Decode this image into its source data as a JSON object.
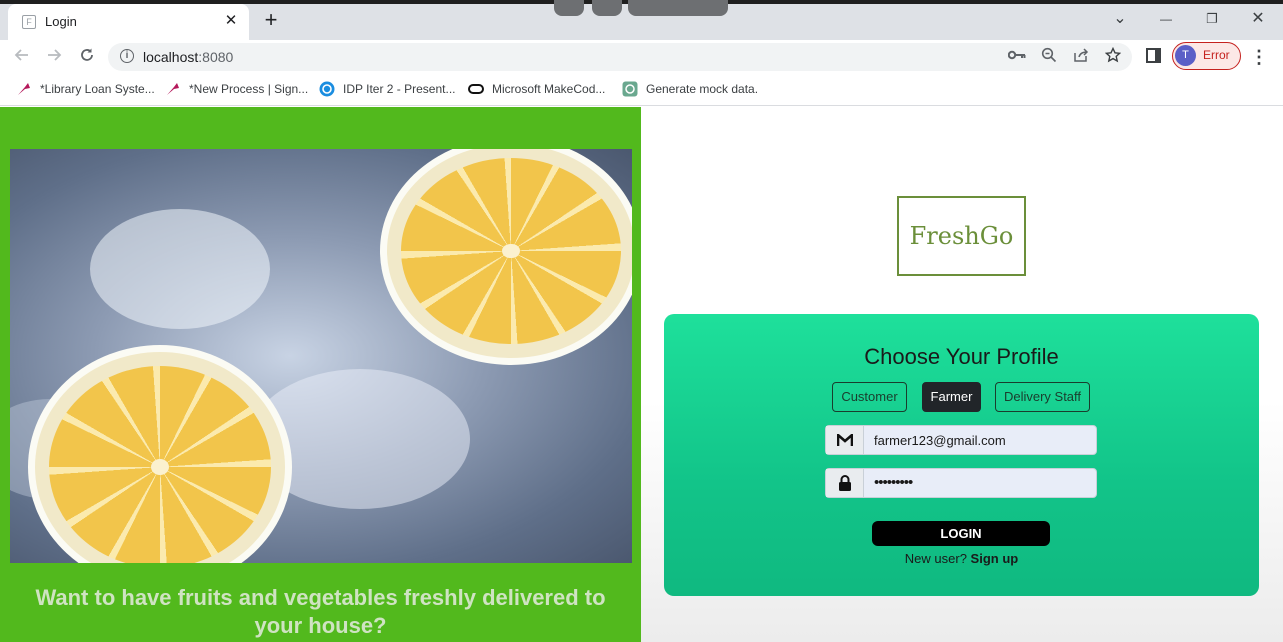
{
  "browser": {
    "tab_title": "Login",
    "tab_favicon": "F",
    "close_glyph": "✕",
    "new_tab_glyph": "+",
    "url_host": "localhost",
    "url_port": ":8080",
    "profile_initial": "T",
    "profile_status": "Error",
    "window_controls": {
      "dropdown": "⌄",
      "minimize": "—",
      "restore": "❐",
      "close": "✕"
    }
  },
  "bookmarks": [
    {
      "label": "*Library Loan Syste...",
      "icon": "pinwheel-icon"
    },
    {
      "label": "*New Process | Sign...",
      "icon": "pinwheel-icon"
    },
    {
      "label": "IDP Iter 2 - Present...",
      "icon": "canva-icon"
    },
    {
      "label": "Microsoft MakeCod...",
      "icon": "makecode-icon"
    },
    {
      "label": "Generate mock data.",
      "icon": "openai-icon"
    }
  ],
  "left": {
    "tagline": "Want to have fruits and vegetables freshly delivered to your house?"
  },
  "login": {
    "logo": "FreshGo",
    "heading": "Choose Your Profile",
    "roles": [
      "Customer",
      "Farmer",
      "Delivery Staff"
    ],
    "active_role": "Farmer",
    "email_value": "farmer123@gmail.com",
    "password_value": "•••••••••",
    "login_label": "LOGIN",
    "new_user_text": "New user?",
    "signup_label": "Sign up"
  },
  "colors": {
    "left_bg": "#52b91d",
    "card_accent": "#1ee09b",
    "logo_green": "#6b8f3a",
    "profile_error": "#c5221f"
  }
}
